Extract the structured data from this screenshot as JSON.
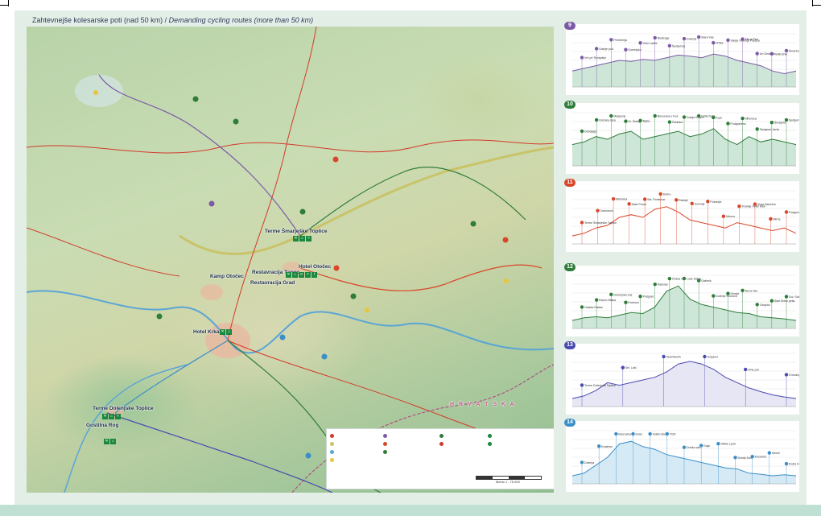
{
  "title": {
    "slovene": "Zahtevnejše kolesarske poti (nad 50 km) / ",
    "english": "Demanding cycling routes (more than 50 km)"
  },
  "map": {
    "places": {
      "terme_smarjeske": "Terme Šmarješke Toplice",
      "hotel_otocec": "Hotel Otočec",
      "kamp_otocec": "Kamp Otočec",
      "restavracija_tango": "Restavracija Tango",
      "restavracija_grad": "Restavracija Grad",
      "hotel_krka": "Hotel Krka",
      "terme_dolenjske": "Terme Dolenjske Toplice",
      "gostilna_rog": "Gostilna Rog",
      "hrvatska": "H R V A T S K A"
    },
    "scale_label": "Merilo 1 : 75 000"
  },
  "profiles": [
    {
      "id": "9",
      "color": "#7b5aa6",
      "fill": "#cde6d7",
      "stations": [
        "Vrh pri Šentjoške",
        "Gabrje pod",
        "Pretreterja",
        "Gorenjsko",
        "Vrhu Laščk",
        "Nuatrage",
        "Šentjernej",
        "Dolenja",
        "Stara Vas",
        "Vrbka",
        "Valeja Vodovja Pauliša",
        "Mirna Peč",
        "Ivo Desnice",
        "Veliki Bnik",
        "Šmartno"
      ]
    },
    {
      "id": "10",
      "color": "#2e7d3a",
      "fill": "#cde6d7",
      "stations": [
        "Debeljaja",
        "Grmska reka",
        "Mašporaj",
        "Sr. Žeheje",
        "Bajra",
        "Brezovica v Koz",
        "Čadrska",
        "Dolnje Kosmi",
        "Veliki Dolis",
        "Kopt",
        "Podgračeno",
        "Mihovica",
        "Tamjaner Jarše",
        "Šmarjeta",
        "Šentjernej"
      ]
    },
    {
      "id": "11",
      "color": "#d9472b",
      "fill": "#ffffff",
      "stations": [
        "Terme Šmarješke Toplice",
        "Zamurovo",
        "Mihovica",
        "Malo Prudo",
        "Sel. Ponkvica",
        "Dobro",
        "Radnje",
        "Gorenje",
        "Pobrežje",
        "Vrhovo",
        "Trebnje Veliki Klek",
        "Vinja Zatočina",
        "Mirna",
        "Podgora"
      ]
    },
    {
      "id": "12",
      "color": "#2e7d3a",
      "fill": "#cde6d7",
      "stations": [
        "Otoška Raška",
        "Ravno Mlaka",
        "Gorenjska vas",
        "Kronovo",
        "Podgrad",
        "Kačerac",
        "Češča vas",
        "Luše Halda",
        "Gabrnik",
        "Dolenje Kronovo",
        "Grunje",
        "Nova Vas",
        "Ovsječa",
        "Stari Brtno pelia",
        "Dol. Sušice"
      ]
    },
    {
      "id": "13",
      "color": "#4a4ab0",
      "fill": "#e6e6f5",
      "stations": [
        "Terme Dolenjske Toplice",
        "Sel. Laši",
        "Velemborih",
        "Gorjanci",
        "Vrhe pot",
        "Črmošnjice"
      ]
    },
    {
      "id": "14",
      "color": "#3b8fc8",
      "fill": "#d6eaf6",
      "stations": [
        "Dolenja",
        "Krasinec",
        "Brezovica",
        "Duše",
        "Vokšo Bosn",
        "Tržič",
        "Drmko vas",
        "Gaja",
        "Velike Ljudi",
        "Dolnje Dole",
        "Kosobrst",
        "Semič",
        "Rožni Dol"
      ]
    }
  ]
}
